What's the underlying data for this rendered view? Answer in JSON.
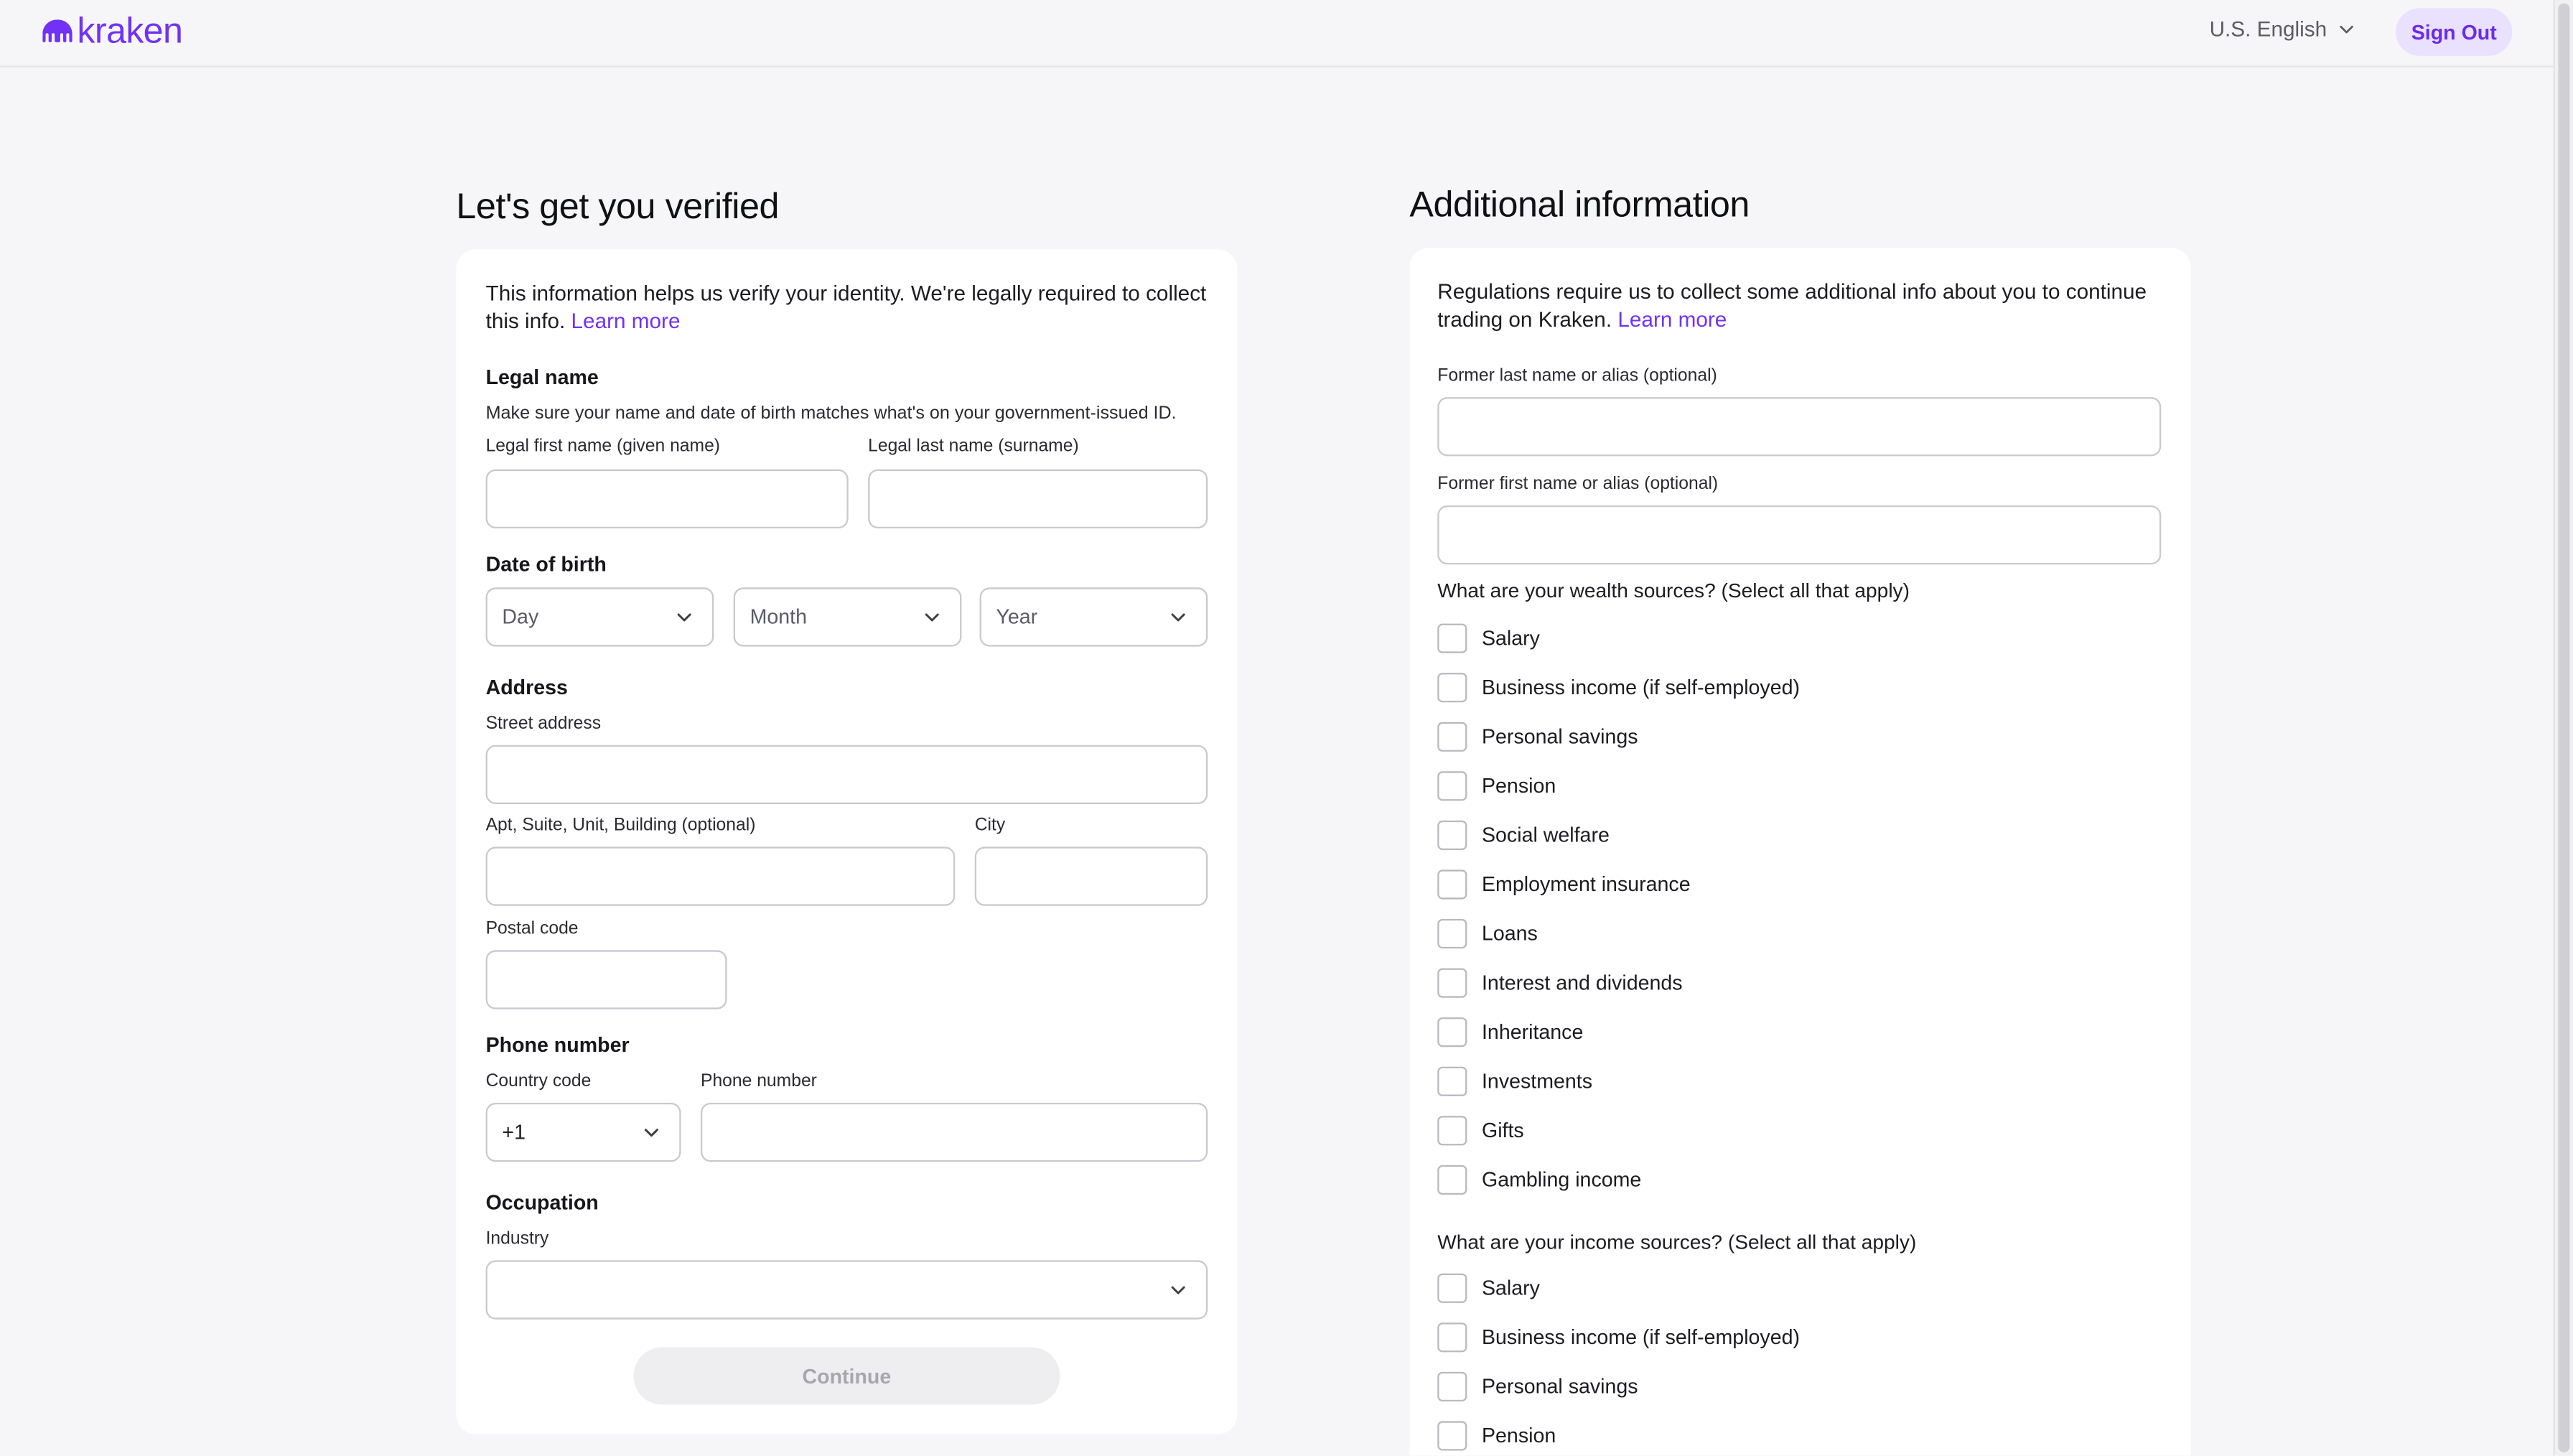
{
  "header": {
    "logo_text": "kraken",
    "language": "U.S. English",
    "sign_out": "Sign Out"
  },
  "left": {
    "title": "Let's get you verified",
    "intro": "This information helps us verify your identity. We're legally required to collect this info.",
    "learn_more": "Learn more",
    "legal_name": {
      "heading": "Legal name",
      "help": "Make sure your name and date of birth matches what's on your government-issued ID.",
      "first_label": "Legal first name (given name)",
      "first_value": "",
      "last_label": "Legal last name (surname)",
      "last_value": ""
    },
    "dob": {
      "heading": "Date of birth",
      "day": "Day",
      "month": "Month",
      "year": "Year"
    },
    "address": {
      "heading": "Address",
      "street_label": "Street address",
      "street_value": "",
      "apt_label": "Apt, Suite, Unit, Building (optional)",
      "apt_value": "",
      "city_label": "City",
      "city_value": "",
      "postal_label": "Postal code",
      "postal_value": ""
    },
    "phone": {
      "heading": "Phone number",
      "country_label": "Country code",
      "country_value": "+1",
      "number_label": "Phone number",
      "number_value": ""
    },
    "occupation": {
      "heading": "Occupation",
      "industry_label": "Industry",
      "industry_value": ""
    },
    "continue": "Continue"
  },
  "right": {
    "title": "Additional information",
    "intro": "Regulations require us to collect some additional info about you to continue trading on Kraken.",
    "learn_more": "Learn more",
    "former_last_label": "Former last name or alias (optional)",
    "former_last_value": "",
    "former_first_label": "Former first name or alias (optional)",
    "former_first_value": "",
    "wealth_question": "What are your wealth sources? (Select all that apply)",
    "wealth_sources": [
      "Salary",
      "Business income (if self-employed)",
      "Personal savings",
      "Pension",
      "Social welfare",
      "Employment insurance",
      "Loans",
      "Interest and dividends",
      "Inheritance",
      "Investments",
      "Gifts",
      "Gambling income"
    ],
    "income_question": "What are your income sources? (Select all that apply)",
    "income_sources": [
      "Salary",
      "Business income (if self-employed)",
      "Personal savings",
      "Pension"
    ]
  },
  "colors": {
    "brand": "#7132f5",
    "sign_out_bg": "#e9e1fd",
    "page_bg": "#f6f6f8",
    "card_bg": "#ffffff",
    "input_border": "#c9c9cf",
    "disabled_button_bg": "#eeeef0"
  },
  "icons": {
    "logo": "kraken-logo-icon",
    "dropdown": "chevron-down-icon"
  }
}
